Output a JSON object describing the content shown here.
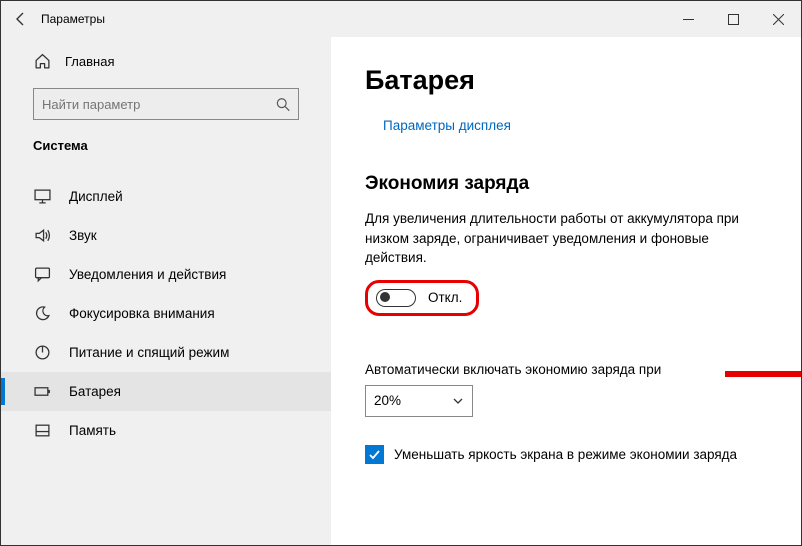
{
  "window": {
    "title": "Параметры"
  },
  "sidebar": {
    "home_label": "Главная",
    "search_placeholder": "Найти параметр",
    "section_label": "Система",
    "items": [
      {
        "label": "Дисплей"
      },
      {
        "label": "Звук"
      },
      {
        "label": "Уведомления и действия"
      },
      {
        "label": "Фокусировка внимания"
      },
      {
        "label": "Питание и спящий режим"
      },
      {
        "label": "Батарея"
      },
      {
        "label": "Память"
      }
    ]
  },
  "content": {
    "page_title": "Батарея",
    "display_link": "Параметры дисплея",
    "saver_section_title": "Экономия заряда",
    "saver_desc": "Для увеличения длительности работы от аккумулятора при низком заряде, ограничивает уведомления и фоновые действия.",
    "toggle_state_label": "Откл.",
    "auto_on_label": "Автоматически включать экономию заряда при",
    "auto_on_value": "20%",
    "brightness_checkbox_label": "Уменьшать яркость экрана в режиме экономии заряда"
  },
  "annotation": {
    "color": "#e60000"
  }
}
